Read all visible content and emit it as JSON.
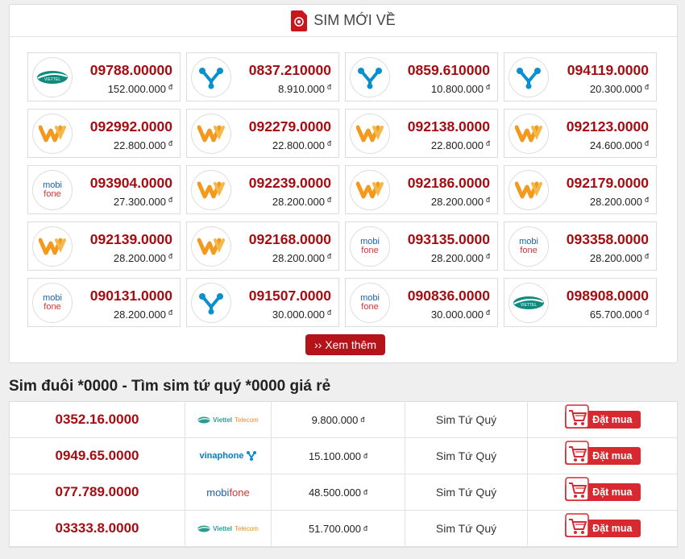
{
  "new_sims": {
    "title": "SIM MỚI VỀ",
    "icon": "sim-card-icon",
    "cards": [
      {
        "number": "09788.00000",
        "price": "152.000.000",
        "carrier": "viettel"
      },
      {
        "number": "0837.210000",
        "price": "8.910.000",
        "carrier": "vinaphone"
      },
      {
        "number": "0859.610000",
        "price": "10.800.000",
        "carrier": "vinaphone"
      },
      {
        "number": "094119.0000",
        "price": "20.300.000",
        "carrier": "vinaphone"
      },
      {
        "number": "092992.0000",
        "price": "22.800.000",
        "carrier": "vietnamobile"
      },
      {
        "number": "092279.0000",
        "price": "22.800.000",
        "carrier": "vietnamobile"
      },
      {
        "number": "092138.0000",
        "price": "22.800.000",
        "carrier": "vietnamobile"
      },
      {
        "number": "092123.0000",
        "price": "24.600.000",
        "carrier": "vietnamobile"
      },
      {
        "number": "093904.0000",
        "price": "27.300.000",
        "carrier": "mobifone"
      },
      {
        "number": "092239.0000",
        "price": "28.200.000",
        "carrier": "vietnamobile"
      },
      {
        "number": "092186.0000",
        "price": "28.200.000",
        "carrier": "vietnamobile"
      },
      {
        "number": "092179.0000",
        "price": "28.200.000",
        "carrier": "vietnamobile"
      },
      {
        "number": "092139.0000",
        "price": "28.200.000",
        "carrier": "vietnamobile"
      },
      {
        "number": "092168.0000",
        "price": "28.200.000",
        "carrier": "vietnamobile"
      },
      {
        "number": "093135.0000",
        "price": "28.200.000",
        "carrier": "mobifone"
      },
      {
        "number": "093358.0000",
        "price": "28.200.000",
        "carrier": "mobifone"
      },
      {
        "number": "090131.0000",
        "price": "28.200.000",
        "carrier": "mobifone"
      },
      {
        "number": "091507.0000",
        "price": "30.000.000",
        "carrier": "vinaphone"
      },
      {
        "number": "090836.0000",
        "price": "30.000.000",
        "carrier": "mobifone"
      },
      {
        "number": "098908.0000",
        "price": "65.700.000",
        "carrier": "viettel"
      }
    ],
    "currency": "đ",
    "more_label": "›› Xem thêm"
  },
  "logos": {
    "mobi_line1": "mobi",
    "mobi_line2": "fone",
    "viettel_word": "VIETTEL",
    "viettel_brand": "Viettel",
    "telecom": "Telecom",
    "vinaphone": "vinaphone",
    "mobifone_a": "mobi",
    "mobifone_b": "fone"
  },
  "section": {
    "title": "Sim đuôi *0000 - Tìm sim tứ quý *0000 giá rẻ"
  },
  "table": {
    "rows": [
      {
        "number": "0352.16.0000",
        "carrier": "viettel",
        "price": "9.800.000",
        "type": "Sim Tứ Quý",
        "buy": "Đặt mua"
      },
      {
        "number": "0949.65.0000",
        "carrier": "vinaphone",
        "price": "15.100.000",
        "type": "Sim Tứ Quý",
        "buy": "Đặt mua"
      },
      {
        "number": "077.789.0000",
        "carrier": "mobifone",
        "price": "48.500.000",
        "type": "Sim Tứ Quý",
        "buy": "Đặt mua"
      },
      {
        "number": "03333.8.0000",
        "carrier": "viettel",
        "price": "51.700.000",
        "type": "Sim Tứ Quý",
        "buy": "Đặt mua"
      }
    ]
  },
  "colors": {
    "accent_red": "#a50d12",
    "button_red": "#b5131a",
    "buy_red": "#d82830",
    "viettel_green": "#0f8a7e",
    "vina_blue": "#0a8fd0",
    "vietnamobile_orange": "#f39a1e",
    "mobifone_blue": "#1662b0"
  }
}
